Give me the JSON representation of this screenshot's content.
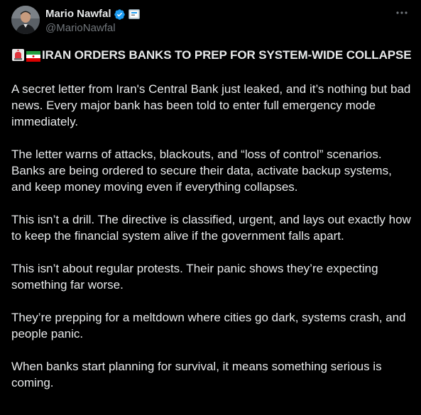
{
  "author": {
    "display_name": "Mario Nawfal",
    "handle": "@MarioNawfal",
    "verified_color": "#1d9bf0"
  },
  "icons": {
    "avatar": "avatar-photo",
    "verified": "verified-badge-icon",
    "affiliation": "affiliation-badge-icon",
    "more": "more-options-icon",
    "siren": "siren-emoji-icon",
    "flag": "iran-flag-emoji-icon"
  },
  "tweet": {
    "headline": "IRAN ORDERS BANKS TO PREP FOR SYSTEM-WIDE COLLAPSE",
    "paragraphs": [
      "A secret letter from Iran's Central Bank just leaked, and it’s nothing but bad news. Every major bank has been told to enter full emergency mode immediately.",
      "The letter warns of attacks, blackouts, and “loss of control” scenarios. Banks are being ordered to secure their data, activate backup systems, and keep money moving even if everything collapses.",
      "This isn’t a drill. The directive is classified, urgent, and lays out exactly how to keep the financial system alive if the government falls apart.",
      "This isn’t about regular protests. Their panic shows they’re expecting something far worse.",
      "They’re prepping for a meltdown where cities go dark, systems crash, and people panic.",
      "When banks start planning for survival, it means something serious is coming."
    ]
  },
  "colors": {
    "background": "#000000",
    "text": "#e7e9ea",
    "secondary_text": "#71767b",
    "accent": "#1d9bf0"
  }
}
